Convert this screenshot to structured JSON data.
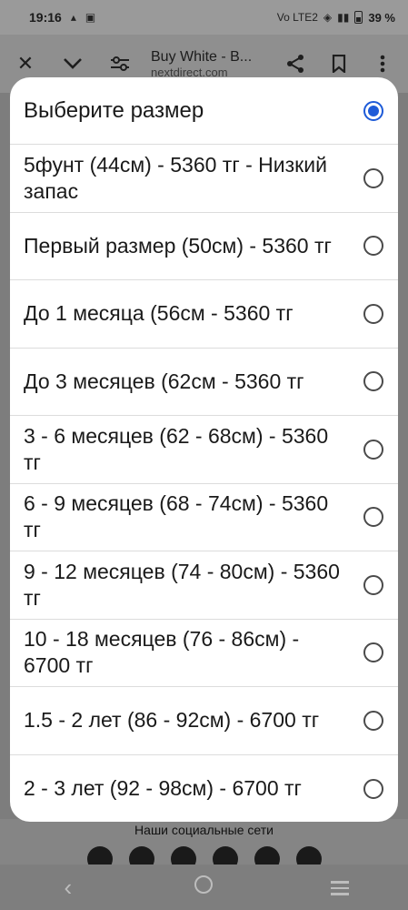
{
  "status_bar": {
    "time": "19:16",
    "network": "Vo LTE2",
    "battery": "39 %"
  },
  "browser": {
    "title": "Buy White - B...",
    "url": "nextdirect.com"
  },
  "background": {
    "social_title": "Наши социальные сети"
  },
  "dialog": {
    "title": "Выберите размер",
    "options": [
      {
        "label": "5фунт (44см) - 5360 тг - Низкий запас"
      },
      {
        "label": "Первый размер (50см) - 5360 тг"
      },
      {
        "label": "До 1 месяца (56см - 5360 тг"
      },
      {
        "label": "До 3 месяцев (62см - 5360 тг"
      },
      {
        "label": "3 - 6 месяцев (62 - 68см) - 5360 тг"
      },
      {
        "label": "6 - 9 месяцев (68 - 74см) - 5360 тг"
      },
      {
        "label": "9 - 12 месяцев (74 - 80см) - 5360 тг"
      },
      {
        "label": "10 - 18 месяцев (76 - 86см) - 6700 тг"
      },
      {
        "label": "1.5 - 2 лет (86 - 92см) - 6700 тг"
      },
      {
        "label": "2 - 3 лет (92 - 98см) - 6700 тг"
      }
    ]
  }
}
